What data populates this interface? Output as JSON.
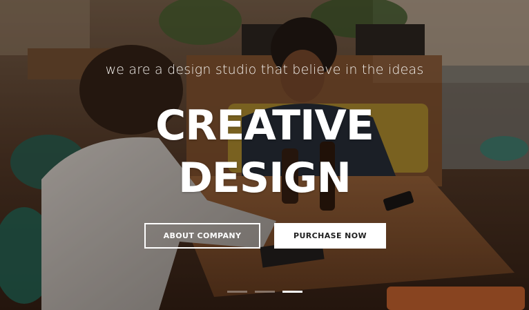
{
  "hero": {
    "tagline": "we are a design studio that believe in the ideas",
    "headline_line1": "CREATIVE",
    "headline_line2": "DESIGN",
    "buttons": {
      "about": "ABOUT COMPANY",
      "purchase": "PURCHASE NOW"
    },
    "slider": {
      "slide_count": 3,
      "active_slide": 3
    },
    "background_image": "cafe-two-men-talking-at-table"
  },
  "colors": {
    "text": "#ffffff",
    "button_solid_bg": "#ffffff",
    "button_solid_text": "#1f1f1f"
  }
}
